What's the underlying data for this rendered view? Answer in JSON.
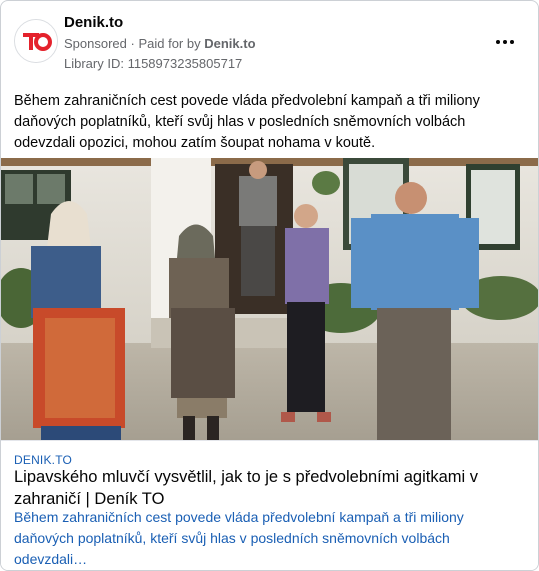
{
  "header": {
    "page_name": "Denik.to",
    "sponsored": "Sponsored",
    "paid_prefix": "Paid for by",
    "paid_by": "Denik.to",
    "library_id": "Library ID: 1158973235805717",
    "logo_text": "TO",
    "menu_icon": "more-options-icon"
  },
  "post": {
    "body": "Během zahraničních cest povede vláda předvolební kampaň a tři miliony daňových poplatníků, kteří svůj hlas v posledních sněmovních volbách odevzdali opozici, mohou zatím šoupat nohama v koutě."
  },
  "link": {
    "domain": "DENIK.TO",
    "headline": "Lipavského mluvčí vysvětlil, jak to je s předvolebními agitkami v zahraničí | Deník TO",
    "description": "Během zahraničních cest povede vláda předvolební kampaň a tři miliony daňových poplatníků, kteří svůj hlas v posledních sněmovních volbách odevzdali…"
  },
  "colors": {
    "brand_red": "#e4222c",
    "link_blue": "#1a5fb4"
  }
}
